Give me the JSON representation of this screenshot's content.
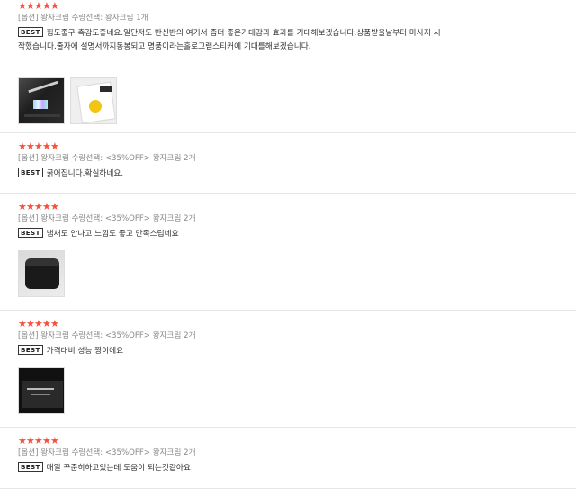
{
  "colors": {
    "star": "#f5513d",
    "option_text": "#888888",
    "divider": "#e6e6e6"
  },
  "icons": {
    "star": "★"
  },
  "reviews": [
    {
      "stars": 5,
      "option": "[옵션] 왕자크림 수량선택: 왕자크림 1개",
      "badge": "BEST",
      "text": "힘도좋구 촉감도좋네요.일단저도 반신반의 여기서 좀더 좋은기대감과 효과를 기대해보겠습니다.상품받을날부터 마사지 시작했습니다.줄자에 설명서까지동봉되고 명품이라는홀로그램스티커에 기대를해보겠습니다.",
      "photos": [
        "box-hologram",
        "card-yellow-sticker"
      ]
    },
    {
      "stars": 5,
      "option": "[옵션] 왕자크림 수량선택: <35%OFF> 왕자크림 2개",
      "badge": "BEST",
      "text": "굵어집니다.확실하네요.",
      "photos": []
    },
    {
      "stars": 5,
      "option": "[옵션] 왕자크림 수량선택: <35%OFF> 왕자크림 2개",
      "badge": "BEST",
      "text": "냄새도 안나고 느낌도 좋고 만족스럽네요",
      "photos": [
        "black-jar"
      ]
    },
    {
      "stars": 5,
      "option": "[옵션] 왕자크림 수량선택: <35%OFF> 왕자크림 2개",
      "badge": "BEST",
      "text": "가격대비 성능 짱이에요",
      "photos": [
        "dark-box"
      ]
    },
    {
      "stars": 5,
      "option": "[옵션] 왕자크림 수량선택: <35%OFF> 왕자크림 2개",
      "badge": "BEST",
      "text": "매일 꾸준히하고있는데 도움이 되는것같아요",
      "photos": []
    }
  ]
}
